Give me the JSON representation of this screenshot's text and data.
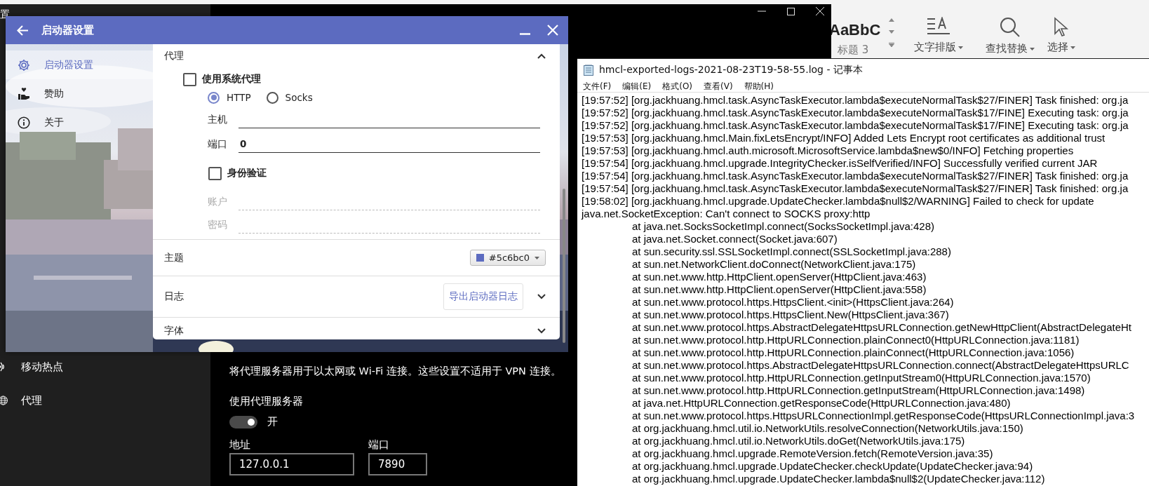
{
  "word_ribbon": {
    "style_preview": "AaBbC",
    "style_name": "标题 3",
    "buttons": [
      {
        "label": "文字排版",
        "kind": "layout"
      },
      {
        "label": "查找替换",
        "kind": "find"
      },
      {
        "label": "选择",
        "kind": "select"
      }
    ]
  },
  "settings_window": {
    "title": "置",
    "sidebar": [
      {
        "label": "移动热点",
        "kind": "hotspot"
      },
      {
        "label": "代理",
        "kind": "proxy"
      }
    ],
    "description": "将代理服务器用于以太网或 Wi-Fi 连接。这些设置不适用于 VPN 连接。",
    "manual_proxy": {
      "label": "使用代理服务器",
      "toggle": {
        "on": true,
        "state_label": "开"
      },
      "address": {
        "label": "地址",
        "value": "127.0.0.1"
      },
      "port": {
        "label": "端口",
        "value": "7890"
      }
    }
  },
  "launcher": {
    "title": "启动器设置",
    "sidebar": [
      {
        "label": "启动器设置",
        "kind": "gear",
        "selected": true
      },
      {
        "label": "赞助",
        "kind": "donate",
        "selected": false
      },
      {
        "label": "关于",
        "kind": "info",
        "selected": false
      }
    ],
    "sections": [
      {
        "kind": "proxy",
        "title": "代理",
        "expanded": true,
        "use_system_proxy": {
          "label": "使用系统代理",
          "checked": false
        },
        "protocols": [
          {
            "label": "HTTP",
            "selected": true
          },
          {
            "label": "Socks",
            "selected": false
          }
        ],
        "fields": [
          {
            "label": "主机",
            "disabled": false
          },
          {
            "label": "端口",
            "value": "0",
            "disabled": false
          }
        ],
        "auth": {
          "label": "身份验证",
          "checked": false
        },
        "auth_fields": [
          {
            "label": "账户",
            "disabled": true
          },
          {
            "label": "密码",
            "disabled": true
          }
        ]
      },
      {
        "kind": "theme",
        "title": "主题",
        "color": "#5c6bc0",
        "value": "#5c6bc0"
      },
      {
        "kind": "log",
        "title": "日志",
        "button": "导出启动器日志",
        "expanded": false
      },
      {
        "kind": "font",
        "title": "字体",
        "expanded": false
      }
    ]
  },
  "notepad": {
    "title": "hmcl-exported-logs-2021-08-23T19-58-55.log - 记事本",
    "menu": [
      "文件(F)",
      "编辑(E)",
      "格式(O)",
      "查看(V)",
      "帮助(H)"
    ],
    "lines": [
      {
        "kind": "entry",
        "text": "[19:57:52] [org.jackhuang.hmcl.task.AsyncTaskExecutor.lambda$executeNormalTask$27/FINER] Task finished: org.ja"
      },
      {
        "kind": "entry",
        "text": "[19:57:52] [org.jackhuang.hmcl.task.AsyncTaskExecutor.lambda$executeNormalTask$17/FINE] Executing task: org.ja"
      },
      {
        "kind": "entry",
        "text": "[19:57:52] [org.jackhuang.hmcl.task.AsyncTaskExecutor.lambda$executeNormalTask$17/FINE] Executing task: org.ja"
      },
      {
        "kind": "entry",
        "text": "[19:57:53] [org.jackhuang.hmcl.Main.fixLetsEncrypt/INFO] Added Lets Encrypt root certificates as additional trust"
      },
      {
        "kind": "entry",
        "text": "[19:57:53] [org.jackhuang.hmcl.auth.microsoft.MicrosoftService.lambda$new$0/INFO] Fetching properties"
      },
      {
        "kind": "entry",
        "text": "[19:57:54] [org.jackhuang.hmcl.upgrade.IntegrityChecker.isSelfVerified/INFO] Successfully verified current JAR"
      },
      {
        "kind": "entry",
        "text": "[19:57:54] [org.jackhuang.hmcl.task.AsyncTaskExecutor.lambda$executeNormalTask$27/FINER] Task finished: org.ja"
      },
      {
        "kind": "entry",
        "text": "[19:57:54] [org.jackhuang.hmcl.task.AsyncTaskExecutor.lambda$executeNormalTask$27/FINER] Task finished: org.ja"
      },
      {
        "kind": "entry",
        "text": "[19:58:02] [org.jackhuang.hmcl.upgrade.UpdateChecker.lambda$null$2/WARNING] Failed to check for update"
      },
      {
        "kind": "entry",
        "text": "java.net.SocketException: Can't connect to SOCKS proxy:http"
      },
      {
        "kind": "frame",
        "text": "at java.net.SocksSocketImpl.connect(SocksSocketImpl.java:428)"
      },
      {
        "kind": "frame",
        "text": "at java.net.Socket.connect(Socket.java:607)"
      },
      {
        "kind": "frame",
        "text": "at sun.security.ssl.SSLSocketImpl.connect(SSLSocketImpl.java:288)"
      },
      {
        "kind": "frame",
        "text": "at sun.net.NetworkClient.doConnect(NetworkClient.java:175)"
      },
      {
        "kind": "frame",
        "text": "at sun.net.www.http.HttpClient.openServer(HttpClient.java:463)"
      },
      {
        "kind": "frame",
        "text": "at sun.net.www.http.HttpClient.openServer(HttpClient.java:558)"
      },
      {
        "kind": "frame",
        "text": "at sun.net.www.protocol.https.HttpsClient.<init>(HttpsClient.java:264)"
      },
      {
        "kind": "frame",
        "text": "at sun.net.www.protocol.https.HttpsClient.New(HttpsClient.java:367)"
      },
      {
        "kind": "frame",
        "text": "at sun.net.www.protocol.https.AbstractDelegateHttpsURLConnection.getNewHttpClient(AbstractDelegateHt"
      },
      {
        "kind": "frame",
        "text": "at sun.net.www.protocol.http.HttpURLConnection.plainConnect0(HttpURLConnection.java:1181)"
      },
      {
        "kind": "frame",
        "text": "at sun.net.www.protocol.http.HttpURLConnection.plainConnect(HttpURLConnection.java:1056)"
      },
      {
        "kind": "frame",
        "text": "at sun.net.www.protocol.https.AbstractDelegateHttpsURLConnection.connect(AbstractDelegateHttpsURLC"
      },
      {
        "kind": "frame",
        "text": "at sun.net.www.protocol.http.HttpURLConnection.getInputStream0(HttpURLConnection.java:1570)"
      },
      {
        "kind": "frame",
        "text": "at sun.net.www.protocol.http.HttpURLConnection.getInputStream(HttpURLConnection.java:1498)"
      },
      {
        "kind": "frame",
        "text": "at java.net.HttpURLConnection.getResponseCode(HttpURLConnection.java:480)"
      },
      {
        "kind": "frame",
        "text": "at sun.net.www.protocol.https.HttpsURLConnectionImpl.getResponseCode(HttpsURLConnectionImpl.java:3"
      },
      {
        "kind": "frame",
        "text": "at org.jackhuang.hmcl.util.io.NetworkUtils.resolveConnection(NetworkUtils.java:150)"
      },
      {
        "kind": "frame",
        "text": "at org.jackhuang.hmcl.util.io.NetworkUtils.doGet(NetworkUtils.java:175)"
      },
      {
        "kind": "frame",
        "text": "at org.jackhuang.hmcl.upgrade.RemoteVersion.fetch(RemoteVersion.java:35)"
      },
      {
        "kind": "frame",
        "text": "at org.jackhuang.hmcl.upgrade.UpdateChecker.checkUpdate(UpdateChecker.java:94)"
      },
      {
        "kind": "frame",
        "text": "at org.jackhuang.hmcl.upgrade.UpdateChecker.lambda$null$2(UpdateChecker.java:112)"
      }
    ]
  }
}
